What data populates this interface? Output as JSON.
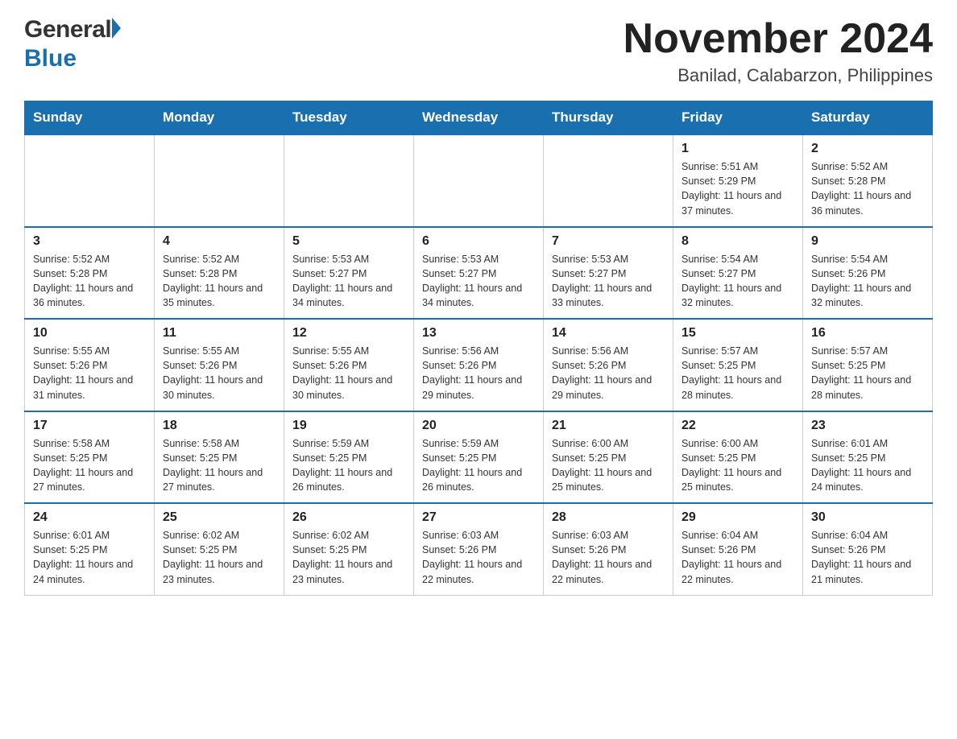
{
  "header": {
    "logo_general": "General",
    "logo_blue": "Blue",
    "month_year": "November 2024",
    "location": "Banilad, Calabarzon, Philippines"
  },
  "days_of_week": [
    "Sunday",
    "Monday",
    "Tuesday",
    "Wednesday",
    "Thursday",
    "Friday",
    "Saturday"
  ],
  "weeks": [
    {
      "days": [
        {
          "number": "",
          "info": ""
        },
        {
          "number": "",
          "info": ""
        },
        {
          "number": "",
          "info": ""
        },
        {
          "number": "",
          "info": ""
        },
        {
          "number": "",
          "info": ""
        },
        {
          "number": "1",
          "info": "Sunrise: 5:51 AM\nSunset: 5:29 PM\nDaylight: 11 hours and 37 minutes."
        },
        {
          "number": "2",
          "info": "Sunrise: 5:52 AM\nSunset: 5:28 PM\nDaylight: 11 hours and 36 minutes."
        }
      ]
    },
    {
      "days": [
        {
          "number": "3",
          "info": "Sunrise: 5:52 AM\nSunset: 5:28 PM\nDaylight: 11 hours and 36 minutes."
        },
        {
          "number": "4",
          "info": "Sunrise: 5:52 AM\nSunset: 5:28 PM\nDaylight: 11 hours and 35 minutes."
        },
        {
          "number": "5",
          "info": "Sunrise: 5:53 AM\nSunset: 5:27 PM\nDaylight: 11 hours and 34 minutes."
        },
        {
          "number": "6",
          "info": "Sunrise: 5:53 AM\nSunset: 5:27 PM\nDaylight: 11 hours and 34 minutes."
        },
        {
          "number": "7",
          "info": "Sunrise: 5:53 AM\nSunset: 5:27 PM\nDaylight: 11 hours and 33 minutes."
        },
        {
          "number": "8",
          "info": "Sunrise: 5:54 AM\nSunset: 5:27 PM\nDaylight: 11 hours and 32 minutes."
        },
        {
          "number": "9",
          "info": "Sunrise: 5:54 AM\nSunset: 5:26 PM\nDaylight: 11 hours and 32 minutes."
        }
      ]
    },
    {
      "days": [
        {
          "number": "10",
          "info": "Sunrise: 5:55 AM\nSunset: 5:26 PM\nDaylight: 11 hours and 31 minutes."
        },
        {
          "number": "11",
          "info": "Sunrise: 5:55 AM\nSunset: 5:26 PM\nDaylight: 11 hours and 30 minutes."
        },
        {
          "number": "12",
          "info": "Sunrise: 5:55 AM\nSunset: 5:26 PM\nDaylight: 11 hours and 30 minutes."
        },
        {
          "number": "13",
          "info": "Sunrise: 5:56 AM\nSunset: 5:26 PM\nDaylight: 11 hours and 29 minutes."
        },
        {
          "number": "14",
          "info": "Sunrise: 5:56 AM\nSunset: 5:26 PM\nDaylight: 11 hours and 29 minutes."
        },
        {
          "number": "15",
          "info": "Sunrise: 5:57 AM\nSunset: 5:25 PM\nDaylight: 11 hours and 28 minutes."
        },
        {
          "number": "16",
          "info": "Sunrise: 5:57 AM\nSunset: 5:25 PM\nDaylight: 11 hours and 28 minutes."
        }
      ]
    },
    {
      "days": [
        {
          "number": "17",
          "info": "Sunrise: 5:58 AM\nSunset: 5:25 PM\nDaylight: 11 hours and 27 minutes."
        },
        {
          "number": "18",
          "info": "Sunrise: 5:58 AM\nSunset: 5:25 PM\nDaylight: 11 hours and 27 minutes."
        },
        {
          "number": "19",
          "info": "Sunrise: 5:59 AM\nSunset: 5:25 PM\nDaylight: 11 hours and 26 minutes."
        },
        {
          "number": "20",
          "info": "Sunrise: 5:59 AM\nSunset: 5:25 PM\nDaylight: 11 hours and 26 minutes."
        },
        {
          "number": "21",
          "info": "Sunrise: 6:00 AM\nSunset: 5:25 PM\nDaylight: 11 hours and 25 minutes."
        },
        {
          "number": "22",
          "info": "Sunrise: 6:00 AM\nSunset: 5:25 PM\nDaylight: 11 hours and 25 minutes."
        },
        {
          "number": "23",
          "info": "Sunrise: 6:01 AM\nSunset: 5:25 PM\nDaylight: 11 hours and 24 minutes."
        }
      ]
    },
    {
      "days": [
        {
          "number": "24",
          "info": "Sunrise: 6:01 AM\nSunset: 5:25 PM\nDaylight: 11 hours and 24 minutes."
        },
        {
          "number": "25",
          "info": "Sunrise: 6:02 AM\nSunset: 5:25 PM\nDaylight: 11 hours and 23 minutes."
        },
        {
          "number": "26",
          "info": "Sunrise: 6:02 AM\nSunset: 5:25 PM\nDaylight: 11 hours and 23 minutes."
        },
        {
          "number": "27",
          "info": "Sunrise: 6:03 AM\nSunset: 5:26 PM\nDaylight: 11 hours and 22 minutes."
        },
        {
          "number": "28",
          "info": "Sunrise: 6:03 AM\nSunset: 5:26 PM\nDaylight: 11 hours and 22 minutes."
        },
        {
          "number": "29",
          "info": "Sunrise: 6:04 AM\nSunset: 5:26 PM\nDaylight: 11 hours and 22 minutes."
        },
        {
          "number": "30",
          "info": "Sunrise: 6:04 AM\nSunset: 5:26 PM\nDaylight: 11 hours and 21 minutes."
        }
      ]
    }
  ]
}
